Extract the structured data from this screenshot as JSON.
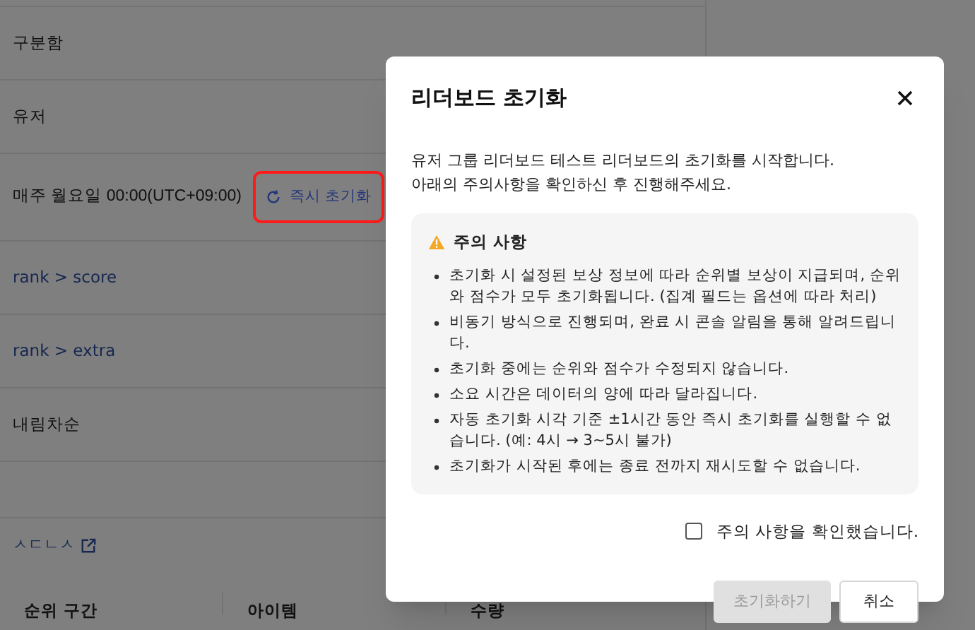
{
  "page": {
    "rows": [
      {
        "kind": "text",
        "value": "구분함"
      },
      {
        "kind": "text",
        "value": "유저"
      },
      {
        "kind": "schedule",
        "value": "매주 월요일 00:00(UTC+09:00)",
        "action": "즉시 초기화"
      },
      {
        "kind": "link",
        "value": "rank > score"
      },
      {
        "kind": "link",
        "value": "rank > extra"
      },
      {
        "kind": "text",
        "value": "내림차순"
      }
    ],
    "section_link": "ㅅㄷㄴㅅ",
    "table": {
      "columns": [
        "순위 구간",
        "아이템",
        "수량"
      ]
    }
  },
  "modal": {
    "title": "리더보드 초기화",
    "description": [
      "유저 그룹 리더보드 테스트 리더보드의 초기화를 시작합니다.",
      "아래의 주의사항을 확인하신 후 진행해주세요."
    ],
    "notice": {
      "title": "주의 사항",
      "items": [
        "초기화 시 설정된 보상 정보에 따라 순위별 보상이 지급되며, 순위와 점수가 모두 초기화됩니다. (집계 필드는 옵션에 따라 처리)",
        "비동기 방식으로 진행되며, 완료 시 콘솔 알림을 통해 알려드립니다.",
        "초기화 중에는 순위와 점수가 수정되지 않습니다.",
        "소요 시간은 데이터의 양에 따라 달라집니다.",
        "자동 초기화 시각 기준 ±1시간 동안 즉시 초기화를 실행할 수 없습니다. (예: 4시 → 3~5시 불가)",
        "초기화가 시작된 후에는 종료 전까지 재시도할 수 없습니다."
      ]
    },
    "confirm_checkbox": {
      "label": "주의 사항을 확인했습니다.",
      "checked": false
    },
    "buttons": [
      {
        "label": "초기화하기",
        "kind": "primary",
        "disabled": true
      },
      {
        "label": "취소",
        "kind": "secondary",
        "disabled": false
      }
    ]
  }
}
